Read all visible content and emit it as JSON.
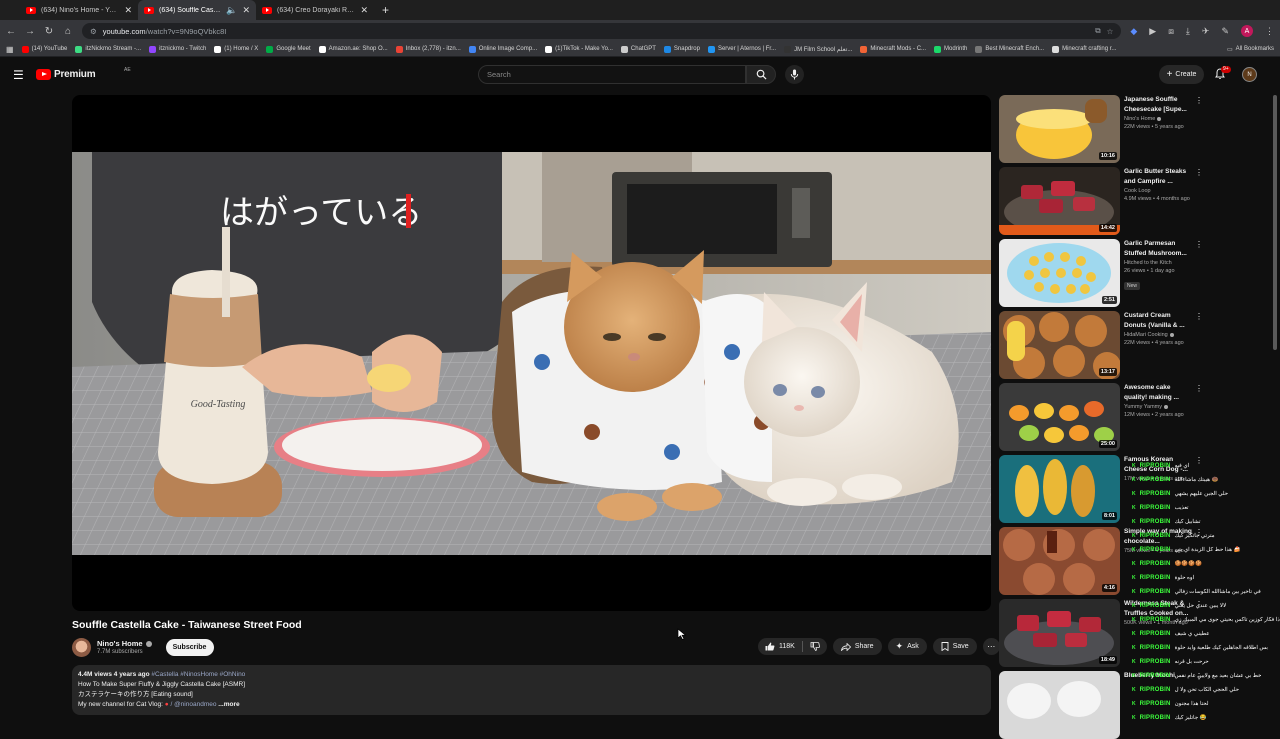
{
  "browser": {
    "tabs": [
      {
        "label": "(634) Nino's Home - YouTube",
        "active": false
      },
      {
        "label": "(634) Souffle Castella Cake",
        "active": true
      },
      {
        "label": "(634) Creo Dorayaki Recipe - J",
        "active": false
      }
    ],
    "new_tab": "+",
    "url_host": "youtube.com",
    "url_path": "/watch?v=9N9oQVbkc8I",
    "bookmarks": [
      {
        "label": "(14) YouTube",
        "color": "#ff0000"
      },
      {
        "label": "itzNickmo Stream -...",
        "color": "#3ddc84"
      },
      {
        "label": "itznickmo - Twitch",
        "color": "#9146ff"
      },
      {
        "label": "(1) Home / X",
        "color": "#ffffff"
      },
      {
        "label": "Google Meet",
        "color": "#00ac47"
      },
      {
        "label": "Amazon.ae: Shop O...",
        "color": "#ffffff"
      },
      {
        "label": "Inbox (2,778) - itzn...",
        "color": "#ea4335"
      },
      {
        "label": "Online Image Comp...",
        "color": "#4285f4"
      },
      {
        "label": "(1)TikTok - Make Yo...",
        "color": "#ffffff"
      },
      {
        "label": "ChatGPT",
        "color": "#cccccc"
      },
      {
        "label": "Snapdrop",
        "color": "#1e88e5"
      },
      {
        "label": "Server | Aternos | Fr...",
        "color": "#2196f3"
      },
      {
        "label": "JM Film School تعلم...",
        "color": "#333333"
      },
      {
        "label": "Minecraft Mods - C...",
        "color": "#f16436"
      },
      {
        "label": "Modrinth",
        "color": "#1bd96a"
      },
      {
        "label": "Best Minecraft Ench...",
        "color": "#777777"
      },
      {
        "label": "Minecraft crafting r...",
        "color": "#dddddd"
      }
    ],
    "all_bookmarks": "All Bookmarks"
  },
  "header": {
    "logo_text": "Premium",
    "country": "AE",
    "search_placeholder": "Search",
    "create_label": "Create",
    "notif_count": "9+",
    "avatar_letter": "N"
  },
  "video": {
    "overlay_text": "はがっている",
    "cup_text": "Good-Tasting",
    "title": "Souffle Castella Cake - Taiwanese Street Food",
    "channel": "Nino's Home",
    "subscribers": "7.7M subscribers",
    "subscribe_label": "Subscribe",
    "likes": "118K",
    "share_label": "Share",
    "ask_label": "Ask",
    "save_label": "Save",
    "views_age": "4.4M views  4 years ago",
    "hashtags": "#Castella #NinosHome #OhNino",
    "desc_line1": "How To Make Super Fluffy & Jiggly Castella Cake [ASMR]",
    "desc_line2": "カステラケーキの作り方 [Eating sound]",
    "desc_line3": "My new channel for Cat Vlog:",
    "desc_link": "/ @ninoandmeo",
    "more_label": "...more"
  },
  "recommendations": [
    {
      "title": "Japanese Souffle Cheesecake [Supe...",
      "channel": "Nino's Home",
      "verified": true,
      "meta": "22M views • 5 years ago",
      "duration": "10:16",
      "is_new": false
    },
    {
      "title": "Garlic Butter Steaks and Campfire ...",
      "channel": "Cook Loop",
      "verified": false,
      "meta": "4.9M views • 4 months ago",
      "duration": "14:42",
      "is_new": false
    },
    {
      "title": "Garlic Parmesan Stuffed Mushroom...",
      "channel": "Hitched to the Kitch",
      "verified": false,
      "meta": "26 views • 1 day ago",
      "duration": "2:51",
      "is_new": true,
      "new_label": "New"
    },
    {
      "title": "Custard Cream Donuts  (Vanilla & ...",
      "channel": "HidaMari Cooking",
      "verified": true,
      "meta": "22M views • 4 years ago",
      "duration": "13:17",
      "is_new": false
    },
    {
      "title": "Awesome cake quality! making ...",
      "channel": "Yummy Yammy",
      "verified": true,
      "meta": "12M views • 2 years ago",
      "duration": "25:00",
      "is_new": false
    },
    {
      "title": "Famous Korean Cheese Corn Dog -...",
      "channel": "",
      "verified": false,
      "meta": "17M views • 4 years ago",
      "duration": "8:01",
      "is_new": false
    },
    {
      "title": "Simple way of making chocolate...",
      "channel": "",
      "verified": false,
      "meta": "75M views • 4 years ago",
      "duration": "4:16",
      "is_new": false
    },
    {
      "title": "Wilderness Steak & Truffles Cooked on...",
      "channel": "",
      "verified": false,
      "meta": "500K views • 1 month ago",
      "duration": "18:49",
      "is_new": false
    },
    {
      "title": "Blueberry Mochi",
      "channel": "",
      "verified": false,
      "meta": "",
      "duration": "",
      "is_new": false
    }
  ],
  "chat_overlay": {
    "name": "RIPROBIN",
    "badge": "K",
    "messages": [
      "اي فيه",
      "هيبتك ماشاءالله 🍩",
      "حلي الجبن عليهم يشهي",
      "تعذيب",
      "تشابيل كيك",
      "مترتي جاتكيز كيك",
      "هذا حط كل الزبدة اي بتي 🍰",
      "🍪🍪🍪🍪",
      "اوه حلوة",
      "في تاخير بين ماشاالله الكوسات زفالي",
      "لالا يبين عندي حل يعني",
      "ذا فكار كوزين تاكس بحيتي جوى مي المبيك زي",
      "عطيني ي شيف",
      "بس اطلاقه الجاهلين كيك طلعية وايد حلوة",
      "حرحت بل قرنه",
      "خط بي عشان بعيد مع ولايين عام نفس",
      "حلي الحجي الكاب تحن ولا ل",
      "لحتا هذا مجنون",
      "جاتليز كيك 😂"
    ]
  }
}
